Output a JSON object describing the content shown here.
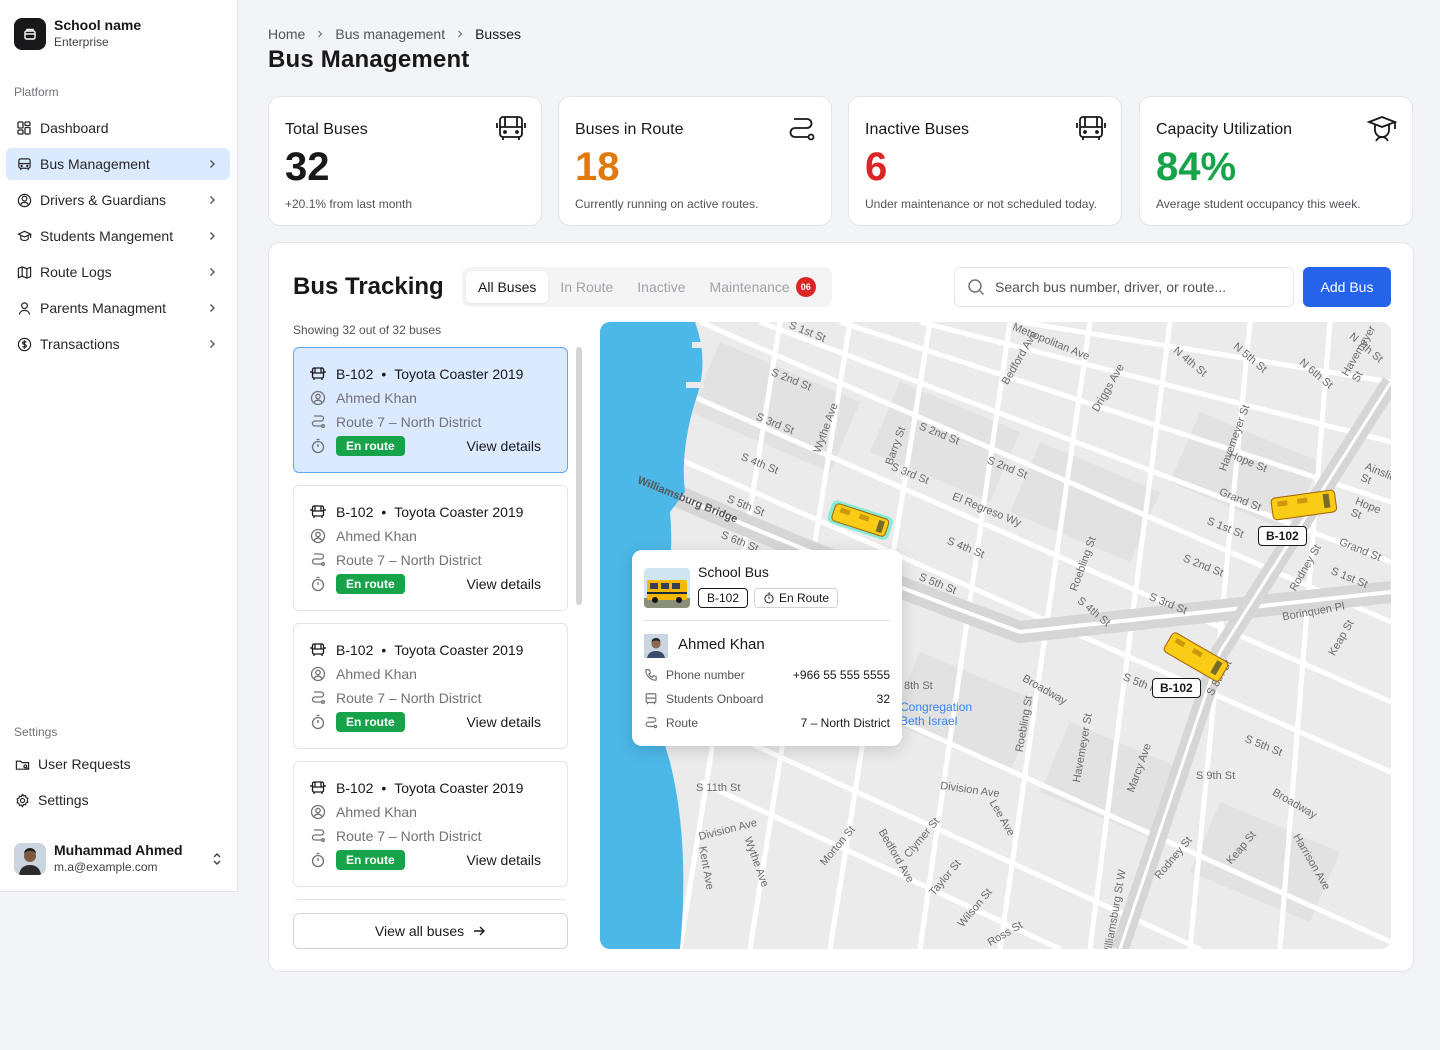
{
  "sidebar": {
    "school_name": "School name",
    "plan": "Enterprise",
    "platform_label": "Platform",
    "items": [
      {
        "label": "Dashboard",
        "icon": "dashboard-icon"
      },
      {
        "label": "Bus Management",
        "icon": "bus-icon"
      },
      {
        "label": "Drivers & Guardians",
        "icon": "drivers-icon"
      },
      {
        "label": "Students Mangement",
        "icon": "graduation-cap-icon"
      },
      {
        "label": "Route Logs",
        "icon": "map-icon"
      },
      {
        "label": "Parents Managment",
        "icon": "user-icon"
      },
      {
        "label": "Transactions",
        "icon": "dollar-circle-icon"
      }
    ],
    "settings_label": "Settings",
    "settings_items": [
      {
        "label": "User Requests",
        "icon": "requests-icon"
      },
      {
        "label": "Settings",
        "icon": "gear-icon"
      }
    ],
    "user": {
      "name": "Muhammad Ahmed",
      "email": "m.a@example.com"
    }
  },
  "breadcrumb": {
    "home": "Home",
    "section": "Bus management",
    "current": "Busses"
  },
  "page_title": "Bus Management",
  "stats": [
    {
      "title": "Total Buses",
      "value": "32",
      "sub": "+20.1% from last month",
      "color": "#18181b",
      "icon": "bus-front-icon"
    },
    {
      "title": "Buses in Route",
      "value": "18",
      "sub": "Currently running on active routes.",
      "color": "#e07a0c",
      "icon": "route-icon"
    },
    {
      "title": "Inactive Buses",
      "value": "6",
      "sub": "Under maintenance or not scheduled today.",
      "color": "#dc2626",
      "icon": "bus-front-icon"
    },
    {
      "title": "Capacity Utilization",
      "value": "84%",
      "sub": "Average student occupancy this week.",
      "color": "#16a34a",
      "icon": "graduation-cap-icon"
    }
  ],
  "tracking": {
    "title": "Bus Tracking",
    "tabs": [
      {
        "label": "All Buses"
      },
      {
        "label": "In Route"
      },
      {
        "label": "Inactive"
      },
      {
        "label": "Maintenance",
        "badge": "06"
      }
    ],
    "search_placeholder": "Search bus number, driver, or route...",
    "add_button": "Add Bus",
    "showing": "Showing 32 out of 32 buses",
    "buses": [
      {
        "number": "B-102",
        "model": "Toyota Coaster 2019",
        "driver": "Ahmed Khan",
        "route": "Route 7 – North District",
        "status": "En route",
        "action": "View details"
      },
      {
        "number": "B-102",
        "model": "Toyota Coaster 2019",
        "driver": "Ahmed Khan",
        "route": "Route 7 – North District",
        "status": "En route",
        "action": "View details"
      },
      {
        "number": "B-102",
        "model": "Toyota Coaster 2019",
        "driver": "Ahmed Khan",
        "route": "Route 7 – North District",
        "status": "En route",
        "action": "View details"
      },
      {
        "number": "B-102",
        "model": "Toyota Coaster 2019",
        "driver": "Ahmed Khan",
        "route": "Route 7 – North District",
        "status": "En route",
        "action": "View details"
      }
    ],
    "view_all": "View all buses"
  },
  "map": {
    "bus_tags": [
      "B-102",
      "B-102"
    ],
    "street_labels": [
      "S 1st St",
      "S 2nd St",
      "S 3rd St",
      "S 4th St",
      "S 5th St",
      "S 6th St",
      "Williamsburg Bridge",
      "Wythe Ave",
      "Barry St",
      "S 2nd St",
      "S 3rd St",
      "S 2nd St",
      "El Regreso Wy",
      "S 4th St",
      "S 5th St",
      "Roebling St",
      "S 4th St",
      "Bedford Ave",
      "Driggs Ave",
      "N 4th St",
      "N 5th St",
      "Hope St",
      "Grand St",
      "S 1st St",
      "S 2nd St",
      "S 3rd St",
      "Havemeyer St",
      "Rodney St",
      "Borinquen Pl",
      "Keap St",
      "Broadway",
      "S 5th Pl",
      "S 8th St",
      "S 9th St",
      "S 5th St",
      "8th St",
      "S 11th St",
      "Division Ave",
      "Division Ave",
      "Lee Ave",
      "Marcy Ave",
      "Havemeyer St",
      "Roebling St",
      "Morton St",
      "Bedford Ave",
      "Clymer St",
      "Taylor St",
      "Wilson St",
      "Ross St",
      "Kent Ave",
      "Wythe Ave",
      "Rodney St",
      "Keap St",
      "Harrison Ave",
      "Broadway",
      "Williamsburg St W",
      "Metropolitan Ave",
      "Havemeyer St",
      "N 6th St",
      "N 7th St",
      "Ainslie St",
      "Grand St",
      "Hope St",
      "S 1st St",
      "Congregation Beth Israel"
    ],
    "popup": {
      "title": "School Bus",
      "bus_number": "B-102",
      "status": "En Route",
      "driver": "Ahmed Khan",
      "phone_label": "Phone number",
      "phone": "+966 55 555 5555",
      "students_label": "Students Onboard",
      "students": "32",
      "route_label": "Route",
      "route": "7 – North District"
    }
  }
}
